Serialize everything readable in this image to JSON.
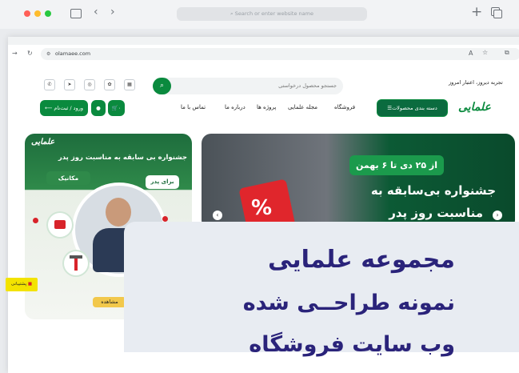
{
  "outer_browser": {
    "address_placeholder": "Search or enter website name"
  },
  "browser": {
    "url": "olamaee.com"
  },
  "site": {
    "tagline": "تجربه دیروز، اعتبار امروز",
    "search_placeholder": "جستجو محصول درخواستی",
    "login_label": "ورود / ثبت‌نام",
    "cart_count": "۰",
    "categories_label": "دسته بندی محصولات",
    "nav": [
      "فروشگاه",
      "مجله علمایی",
      "پروژه ها",
      "درباره ما",
      "تماس با ما"
    ],
    "logo_text": "علمایی"
  },
  "banner_right": {
    "date_badge": "از ۲۵ دی تا ۶ بهمن",
    "title_line1": "جشنواره بی‌سابقه به",
    "title_line2": "مناسبت روز پدر"
  },
  "banner_left": {
    "logo_text": "علمایی",
    "title": "جشنواره بی سابقه به مناسبت روز پدر",
    "tag_mechanic": "مکانیک",
    "tag_father": "برای پدر",
    "view_button": "مشاهده"
  },
  "support_label": "پشتیبانی",
  "overlay": {
    "line1": "مجموعه علمایی",
    "line2": "نمونه طراحــی شده",
    "line3": "وب سایت فروشگاه"
  },
  "colors": {
    "brand_green": "#0a8a3e",
    "overlay_text": "#2a237a"
  }
}
